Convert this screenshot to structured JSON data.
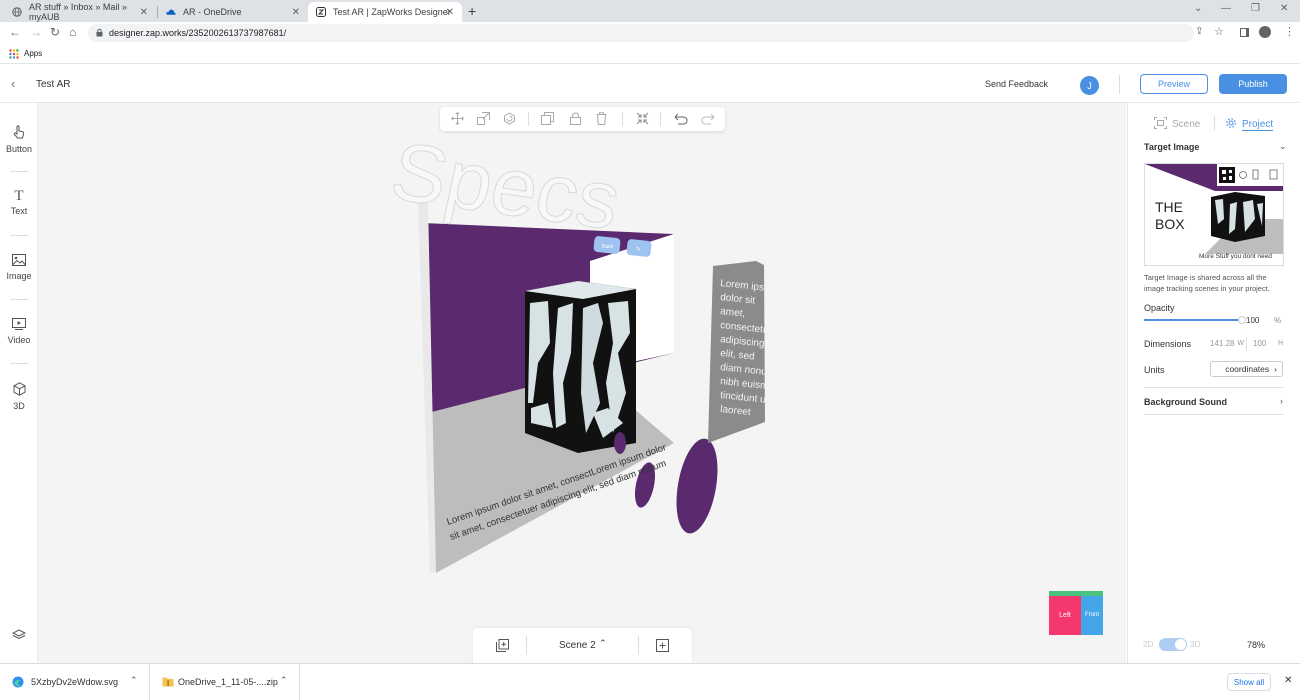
{
  "browser": {
    "tabs": [
      {
        "title": "AR stuff » Inbox » Mail » myAUB",
        "active": false
      },
      {
        "title": "AR - OneDrive",
        "active": false
      },
      {
        "title": "Test AR | ZapWorks Designer",
        "active": true
      }
    ],
    "new_tab": "+",
    "url": "designer.zap.works/2352002613737987681/",
    "bookmarks": {
      "apps_label": "Apps"
    }
  },
  "app": {
    "project_name": "Test AR",
    "send_feedback": "Send Feedback",
    "avatar_initial": "J",
    "preview_label": "Preview",
    "publish_label": "Publish",
    "accent_color": "#4a90e2"
  },
  "tools": [
    {
      "label": "Button",
      "icon": "hand-pointer-icon"
    },
    {
      "label": "Text",
      "icon": "text-T-icon"
    },
    {
      "label": "Image",
      "icon": "image-icon"
    },
    {
      "label": "Video",
      "icon": "video-play-icon"
    },
    {
      "label": "3D",
      "icon": "cube-icon"
    }
  ],
  "canvas": {
    "specs_text": "Specs",
    "buttons": [
      "Back",
      "Tr"
    ],
    "side_panel_text": "Lorem ipsum dolor sit amet, consectetuer adipiscing elit, sed diam nonummy nibh euismod tincidunt ut laoreet dolore",
    "floor_text": "Lorem ipsum dolor sit amet, consectLorem ipsum dolor sit amet, consectetuer adipiscing elit, sed diam nonum",
    "scene_name": "Scene 2",
    "cube_faces": {
      "left": "Left",
      "front": "Front"
    },
    "brand_purple": "#5b2a6e"
  },
  "panel": {
    "tab_scene": "Scene",
    "tab_project": "Project",
    "target_image_title": "Target Image",
    "target_thumb": {
      "title_line1": "THE",
      "title_line2": "BOX",
      "caption": "More Stuff you dont need"
    },
    "target_note": "Target Image is shared across all the image tracking scenes in your project.",
    "opacity_label": "Opacity",
    "opacity_value": "100",
    "opacity_unit": "%",
    "opacity_fraction": 1.0,
    "dimensions_label": "Dimensions",
    "dim_w": "141.28",
    "dim_w_unit": "W",
    "dim_h": "100",
    "dim_h_unit": "H",
    "units_label": "Units",
    "units_value": "coordinates",
    "background_sound": "Background Sound",
    "mode_2d": "2D",
    "mode_3d": "3D",
    "zoom": "78%"
  },
  "downloads": {
    "items": [
      {
        "name": "5XzbyDv2eWdow.svg"
      },
      {
        "name": "OneDrive_1_11-05-....zip"
      }
    ],
    "show_all": "Show all"
  }
}
